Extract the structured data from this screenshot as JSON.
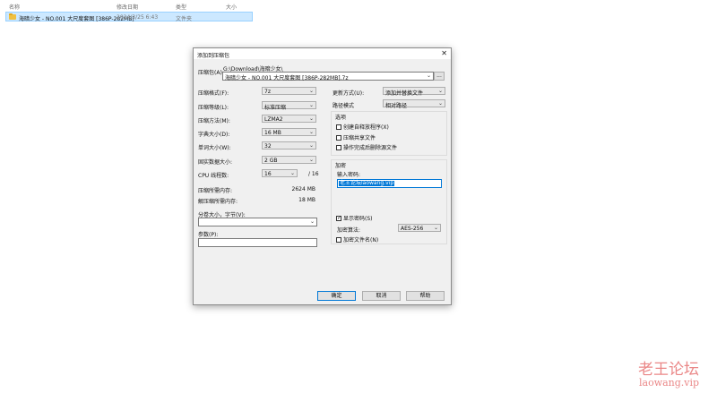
{
  "explorer": {
    "columns": [
      "名称",
      "修改日期",
      "类型",
      "大小"
    ],
    "file": {
      "name": "海暗少女 - NO.001 大尺度套图 [386P-282MB]",
      "date": "2024/3/25 6:43",
      "type": "文件夹"
    }
  },
  "dialog": {
    "title": "添加到压缩包",
    "archive_label": "压缩包(A):",
    "archive_path": "G:\\Download\\海暗少女\\",
    "archive_name": "海暗少女 - NO.001 大尺度套图 [386P-282MB].7z",
    "browse_label": "...",
    "format_label": "压缩格式(F):",
    "format_value": "7z",
    "level_label": "压缩等级(L):",
    "level_value": "标准压缩",
    "method_label": "压缩方法(M):",
    "method_value": "LZMA2",
    "dict_label": "字典大小(D):",
    "dict_value": "16 MB",
    "word_label": "单词大小(W):",
    "word_value": "32",
    "solid_label": "固实数据大小:",
    "solid_value": "2 GB",
    "cpu_label": "CPU 线程数:",
    "cpu_value": "16",
    "cpu_total": "/ 16",
    "mem_comp_label": "压缩所需内存:",
    "mem_comp_value": "2624 MB",
    "mem_decomp_label": "解压缩所需内存:",
    "mem_decomp_value": "18 MB",
    "split_label": "分卷大小，字节(V):",
    "params_label": "参数(P):",
    "update_label": "更新方式(U):",
    "update_value": "添加并替换文件",
    "path_label": "路径模式",
    "path_value": "相对路径",
    "options_title": "选项",
    "opt_sfx": "创建自释放程序(X)",
    "opt_shared": "压缩共享文件",
    "opt_delete": "操作完成后删除源文件",
    "enc_title": "加密",
    "pwd_label": "输入密码:",
    "pwd_value": "老王论坛laowang.vip",
    "show_pwd": "显示密码(S)",
    "enc_method_label": "加密算法:",
    "enc_method_value": "AES-256",
    "enc_names": "加密文件名(N)",
    "ok": "确定",
    "cancel": "取消",
    "help": "帮助"
  },
  "watermark": {
    "cn": "老王论坛",
    "url": "laowang.vip"
  }
}
